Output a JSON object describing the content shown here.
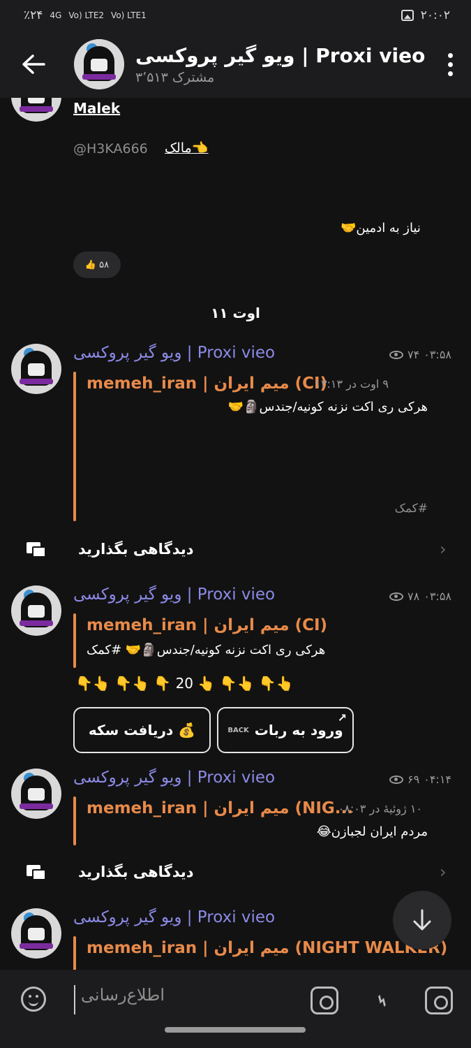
{
  "status_bar": {
    "battery": "٪۲۴",
    "signal_1": "4G",
    "signal_2": "Vo) LTE2",
    "signal_3": "Vo) LTE1",
    "time": "۲۰:۰۲"
  },
  "header": {
    "title": "ویو گیر پروکسی | Proxi vieo",
    "subscribers": "۳٬۵۱۳ مشترک"
  },
  "owner_card": {
    "name": "Malek",
    "handle": "@H3KA666",
    "role": "مالک👈",
    "need_admin": "نیاز به ادمین🤝",
    "reaction": "👍 ۵۸"
  },
  "date_separator": "۱۱ اوت",
  "posts": [
    {
      "channel": "ویو گیر پروکسی | Proxi vieo",
      "views": "۷۴",
      "time": "۰۳:۵۸",
      "forward_source": "memeh_iran | میم ایران (CI)",
      "forward_date": "۹ اوت در ۱۳:۱۳",
      "text": "هرکی ری اکت نزنه کونیه/جندس🗿🤝",
      "hashtag": "#کمک",
      "comment_label": "دیدگاهی بگذارید"
    },
    {
      "channel": "ویو گیر پروکسی | Proxi vieo",
      "views": "۷۸",
      "time": "۰۳:۵۸",
      "forward_source": "memeh_iran | میم ایران (CI)",
      "text": "هرکی ری اکت نزنه کونیه/جندس🗿🤝 #کمک",
      "emoji_line": "👇👆 👇👆 👇 20 👆 👇👆 👇👆",
      "button_1": "ورود به ربات",
      "button_1_icon": "BACK",
      "button_2": "دریافت سکه 💰"
    },
    {
      "channel": "ویو گیر پروکسی | Proxi vieo",
      "views": "۶۹",
      "time": "۰۴:۱۴",
      "forward_source": "memeh_iran | میم ایران (NIG...",
      "forward_date": "۱۰ ژوئیهٔ در ۰۸:۰۳",
      "text": "مردم ایران لجبازن😂",
      "comment_label": "دیدگاهی بگذارید"
    },
    {
      "channel": "ویو گیر پروکسی | Proxi vieo",
      "forward_source": "memeh_iran | میم ایران (NIGHT WALKER)"
    }
  ],
  "composer": {
    "placeholder": "اطلاع‌رسانی"
  }
}
